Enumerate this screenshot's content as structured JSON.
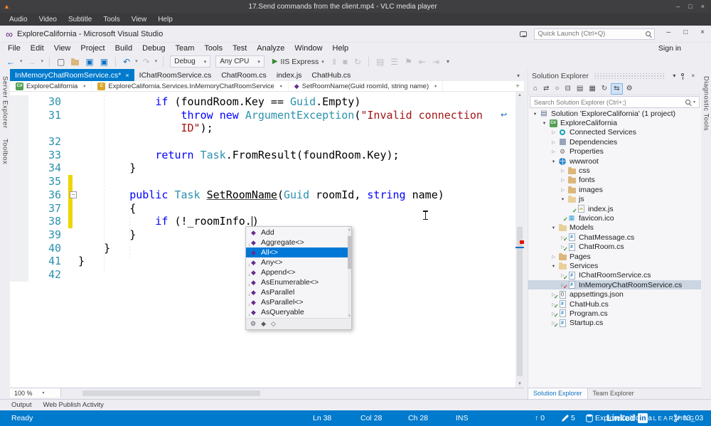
{
  "colors": {
    "accent": "#007acc",
    "keyword": "#0000ff",
    "type": "#2b91af",
    "string": "#a31515",
    "line_number": "#2b91af",
    "selection": "#0078d7",
    "changed_line": "#f0d500",
    "inactive_selection": "#ccd5e2"
  },
  "vlc": {
    "title": "17.Send commands from the client.mp4 - VLC media player",
    "menu": [
      "Audio",
      "Video",
      "Subtitle",
      "Tools",
      "View",
      "Help"
    ],
    "window_buttons": [
      "–",
      "□",
      "×"
    ]
  },
  "vs": {
    "title": "ExploreCalifornia - Microsoft Visual Studio",
    "quick_launch_placeholder": "Quick Launch (Ctrl+Q)",
    "sign_in": "Sign in",
    "window_buttons": [
      "–",
      "□",
      "×"
    ],
    "menu": [
      "File",
      "Edit",
      "View",
      "Project",
      "Build",
      "Debug",
      "Team",
      "Tools",
      "Test",
      "Analyze",
      "Window",
      "Help"
    ],
    "left_tabs": [
      "Server Explorer",
      "Toolbox"
    ],
    "right_tabs": [
      "Diagnostic Tools"
    ],
    "toolbar": {
      "groups": [
        {
          "type": "icons",
          "items": [
            {
              "g": "←",
              "n": "nav-back-icon",
              "c": "blue"
            },
            {
              "g": "▾",
              "n": "nav-back-dropdown-icon",
              "c": "car"
            },
            {
              "g": "→",
              "n": "nav-forward-icon",
              "c": "dim"
            },
            {
              "g": "▾",
              "n": "nav-forward-dropdown-icon",
              "c": "car"
            }
          ]
        },
        {
          "type": "sep"
        },
        {
          "type": "icons",
          "items": [
            {
              "g": "▢",
              "n": "new-file-icon",
              "c": ""
            },
            {
              "g": "folder",
              "n": "open-file-icon",
              "c": "folder"
            },
            {
              "g": "▣",
              "n": "save-icon",
              "c": "blue"
            },
            {
              "g": "▣",
              "n": "save-all-icon",
              "c": "blue"
            }
          ]
        },
        {
          "type": "sep"
        },
        {
          "type": "icons",
          "items": [
            {
              "g": "↶",
              "n": "undo-icon",
              "c": "blue"
            },
            {
              "g": "▾",
              "n": "undo-dropdown-icon",
              "c": "car"
            },
            {
              "g": "↷",
              "n": "redo-icon",
              "c": "dim"
            },
            {
              "g": "▾",
              "n": "redo-dropdown-icon",
              "c": "car"
            }
          ]
        },
        {
          "type": "sep"
        },
        {
          "type": "dd",
          "label": "Debug",
          "n": "configuration-dropdown"
        },
        {
          "type": "dd",
          "label": "Any CPU",
          "n": "platform-dropdown"
        },
        {
          "type": "run",
          "label": "IIS Express",
          "n": "start-debugging-button"
        },
        {
          "type": "icons",
          "items": [
            {
              "g": "‖",
              "n": "pause-icon",
              "c": "dim"
            },
            {
              "g": "■",
              "n": "stop-icon",
              "c": "dim"
            },
            {
              "g": "↻",
              "n": "restart-icon",
              "c": "dim"
            }
          ]
        },
        {
          "type": "sep"
        },
        {
          "type": "icons",
          "items": [
            {
              "g": "▤",
              "n": "find-in-files-icon",
              "c": "dim"
            },
            {
              "g": "☰",
              "n": "toggle-comment-icon",
              "c": "dim"
            },
            {
              "g": "⚑",
              "n": "bookmark-icon",
              "c": "dim"
            },
            {
              "g": "⇤",
              "n": "outdent-icon",
              "c": "dim"
            },
            {
              "g": "⇥",
              "n": "indent-icon",
              "c": "dim"
            }
          ]
        },
        {
          "type": "overflow"
        }
      ]
    }
  },
  "editor": {
    "tabs": [
      {
        "label": "InMemoryChatRoomService.cs*",
        "active": true
      },
      {
        "label": "IChatRoomService.cs"
      },
      {
        "label": "ChatRoom.cs"
      },
      {
        "label": "index.js"
      },
      {
        "label": "ChatHub.cs"
      }
    ],
    "breadcrumb": [
      {
        "label": "ExploreCalifornia",
        "icon": "project"
      },
      {
        "label": "ExploreCalifornia.Services.InMemoryChatRoomService",
        "icon": "class"
      },
      {
        "label": "SetRoomName(Guid roomId, string name)",
        "icon": "method"
      }
    ],
    "zoom": "100 %",
    "word_wrap_glyph": "↩",
    "lines": [
      {
        "num": "30",
        "segs": [
          [
            "            ",
            "pl"
          ],
          [
            "if",
            "kw"
          ],
          [
            " (foundRoom.Key == ",
            "pl"
          ],
          [
            "Guid",
            "ty"
          ],
          [
            ".Empty)",
            "pl"
          ]
        ]
      },
      {
        "num": "31",
        "wrap_glyph": true,
        "segs": [
          [
            "                ",
            "pl"
          ],
          [
            "throw",
            "kw"
          ],
          [
            " ",
            "pl"
          ],
          [
            "new",
            "kw"
          ],
          [
            " ",
            "pl"
          ],
          [
            "ArgumentException",
            "ty"
          ],
          [
            "(",
            "pl"
          ],
          [
            "\"Invalid connection",
            "st"
          ]
        ]
      },
      {
        "num": "",
        "segs": [
          [
            "                ",
            "pl"
          ],
          [
            "ID\"",
            "st"
          ],
          [
            ");",
            "pl"
          ]
        ]
      },
      {
        "num": "32",
        "segs": []
      },
      {
        "num": "33",
        "segs": [
          [
            "            ",
            "pl"
          ],
          [
            "return",
            "kw"
          ],
          [
            " ",
            "pl"
          ],
          [
            "Task",
            "ty"
          ],
          [
            ".FromResult(foundRoom.Key);",
            "pl"
          ]
        ]
      },
      {
        "num": "34",
        "segs": [
          [
            "        }",
            "pl"
          ]
        ]
      },
      {
        "num": "35",
        "changed": true,
        "segs": []
      },
      {
        "num": "36",
        "changed": true,
        "outline": true,
        "segs": [
          [
            "        ",
            "pl"
          ],
          [
            "public",
            "kw"
          ],
          [
            " ",
            "pl"
          ],
          [
            "Task",
            "ty"
          ],
          [
            " ",
            "pl"
          ],
          [
            "SetRoomName",
            "hl"
          ],
          [
            "(",
            "pl"
          ],
          [
            "Guid",
            "ty"
          ],
          [
            " roomId, ",
            "pl"
          ],
          [
            "string",
            "kw"
          ],
          [
            " name)",
            "pl"
          ]
        ]
      },
      {
        "num": "37",
        "changed": true,
        "segs": [
          [
            "        {",
            "pl"
          ]
        ]
      },
      {
        "num": "38",
        "changed": true,
        "segs": [
          [
            "            ",
            "pl"
          ],
          [
            "if",
            "kw"
          ],
          [
            " (!_roomInfo.",
            "pl"
          ],
          [
            "",
            "caret"
          ],
          [
            ")",
            "er"
          ]
        ]
      },
      {
        "num": "39",
        "segs": [
          [
            "        }",
            "pl"
          ]
        ]
      },
      {
        "num": "40",
        "segs": [
          [
            "    }",
            "pl"
          ]
        ]
      },
      {
        "num": "41",
        "segs": [
          [
            "}",
            "pl"
          ]
        ]
      },
      {
        "num": "42",
        "segs": []
      }
    ]
  },
  "intellisense": {
    "items": [
      {
        "label": "Add",
        "kind": "method"
      },
      {
        "label": "Aggregate<>",
        "kind": "extension"
      },
      {
        "label": "All<>",
        "kind": "extension",
        "selected": true
      },
      {
        "label": "Any<>",
        "kind": "extension"
      },
      {
        "label": "Append<>",
        "kind": "extension"
      },
      {
        "label": "AsEnumerable<>",
        "kind": "extension"
      },
      {
        "label": "AsParallel",
        "kind": "extension"
      },
      {
        "label": "AsParallel<>",
        "kind": "extension"
      },
      {
        "label": "AsQueryable",
        "kind": "extension"
      }
    ],
    "footer_icons": [
      {
        "g": "⚙",
        "n": "filter-settings-icon"
      },
      {
        "g": "◆",
        "n": "filter-methods-icon"
      },
      {
        "g": "◇",
        "n": "filter-extension-methods-icon"
      }
    ]
  },
  "solution_explorer": {
    "title": "Solution Explorer",
    "header_icons": [
      {
        "g": "▾",
        "n": "window-position-icon"
      },
      {
        "g": "pin",
        "n": "auto-hide-pin-icon"
      },
      {
        "g": "×",
        "n": "close-icon"
      }
    ],
    "toolbar_icons": [
      {
        "g": "⌂",
        "n": "home-icon"
      },
      {
        "g": "⇄",
        "n": "switch-views-icon"
      },
      {
        "g": "○",
        "n": "pending-changes-filter-icon"
      },
      {
        "g": "⊟",
        "n": "collapse-all-icon"
      },
      {
        "g": "▤",
        "n": "properties-icon"
      },
      {
        "g": "▦",
        "n": "show-all-files-icon"
      },
      {
        "g": "↻",
        "n": "refresh-icon"
      },
      {
        "g": "⇆",
        "n": "sync-with-active-document-icon",
        "active": true
      },
      {
        "g": "⚙",
        "n": "solution-explorer-settings-icon"
      }
    ],
    "search_placeholder": "Search Solution Explorer (Ctrl+;)",
    "tree": [
      {
        "label": "Solution 'ExploreCalifornia' (1 project)",
        "depth": 0,
        "expander": "open",
        "icon": "sln"
      },
      {
        "label": "ExploreCalifornia",
        "depth": 1,
        "expander": "open",
        "icon": "proj"
      },
      {
        "label": "Connected Services",
        "depth": 2,
        "expander": "closed",
        "icon": "svc"
      },
      {
        "label": "Dependencies",
        "depth": 2,
        "expander": "closed",
        "icon": "dep"
      },
      {
        "label": "Properties",
        "depth": 2,
        "expander": "closed",
        "icon": "props"
      },
      {
        "label": "wwwroot",
        "depth": 2,
        "expander": "open",
        "icon": "www"
      },
      {
        "label": "css",
        "depth": 3,
        "expander": "closed",
        "icon": "folder"
      },
      {
        "label": "fonts",
        "depth": 3,
        "expander": "closed",
        "icon": "folder"
      },
      {
        "label": "images",
        "depth": 3,
        "expander": "closed",
        "icon": "folder"
      },
      {
        "label": "js",
        "depth": 3,
        "expander": "open",
        "icon": "folder-open"
      },
      {
        "label": "index.js",
        "depth": 4,
        "expander": null,
        "icon": "js",
        "check": "green"
      },
      {
        "label": "favicon.ico",
        "depth": 3,
        "expander": null,
        "icon": "img",
        "check": "green"
      },
      {
        "label": "Models",
        "depth": 2,
        "expander": "open",
        "icon": "folder-open"
      },
      {
        "label": "ChatMessage.cs",
        "depth": 3,
        "expander": "closed",
        "icon": "cs",
        "check": "green"
      },
      {
        "label": "ChatRoom.cs",
        "depth": 3,
        "expander": "closed",
        "icon": "cs",
        "check": "green"
      },
      {
        "label": "Pages",
        "depth": 2,
        "expander": "closed",
        "icon": "folder"
      },
      {
        "label": "Services",
        "depth": 2,
        "expander": "open",
        "icon": "folder-open"
      },
      {
        "label": "IChatRoomService.cs",
        "depth": 3,
        "expander": "closed",
        "icon": "cs",
        "check": "green"
      },
      {
        "label": "InMemoryChatRoomService.cs",
        "depth": 3,
        "expander": "closed",
        "icon": "cs",
        "check": "red",
        "selected": true
      },
      {
        "label": "appsettings.json",
        "depth": 2,
        "expander": "closed",
        "icon": "json",
        "check": "green"
      },
      {
        "label": "ChatHub.cs",
        "depth": 2,
        "expander": "closed",
        "icon": "cs",
        "check": "green"
      },
      {
        "label": "Program.cs",
        "depth": 2,
        "expander": "closed",
        "icon": "cs",
        "check": "green"
      },
      {
        "label": "Startup.cs",
        "depth": 2,
        "expander": "closed",
        "icon": "cs",
        "check": "green"
      }
    ],
    "bottom_tabs": [
      {
        "label": "Solution Explorer",
        "active": true
      },
      {
        "label": "Team Explorer"
      }
    ]
  },
  "output_tabs": [
    "Output",
    "Web Publish Activity"
  ],
  "status": {
    "ready": "Ready",
    "line": "Ln 38",
    "column": "Col 28",
    "character": "Ch 28",
    "mode": "INS",
    "outgoing_commits": "0",
    "pending_changes": "5",
    "repository": "ExploreCalifornia",
    "branch": "03_03"
  },
  "watermark": {
    "brand_left": "Linked",
    "brand_in": "in",
    "learning": "LEARNING"
  }
}
